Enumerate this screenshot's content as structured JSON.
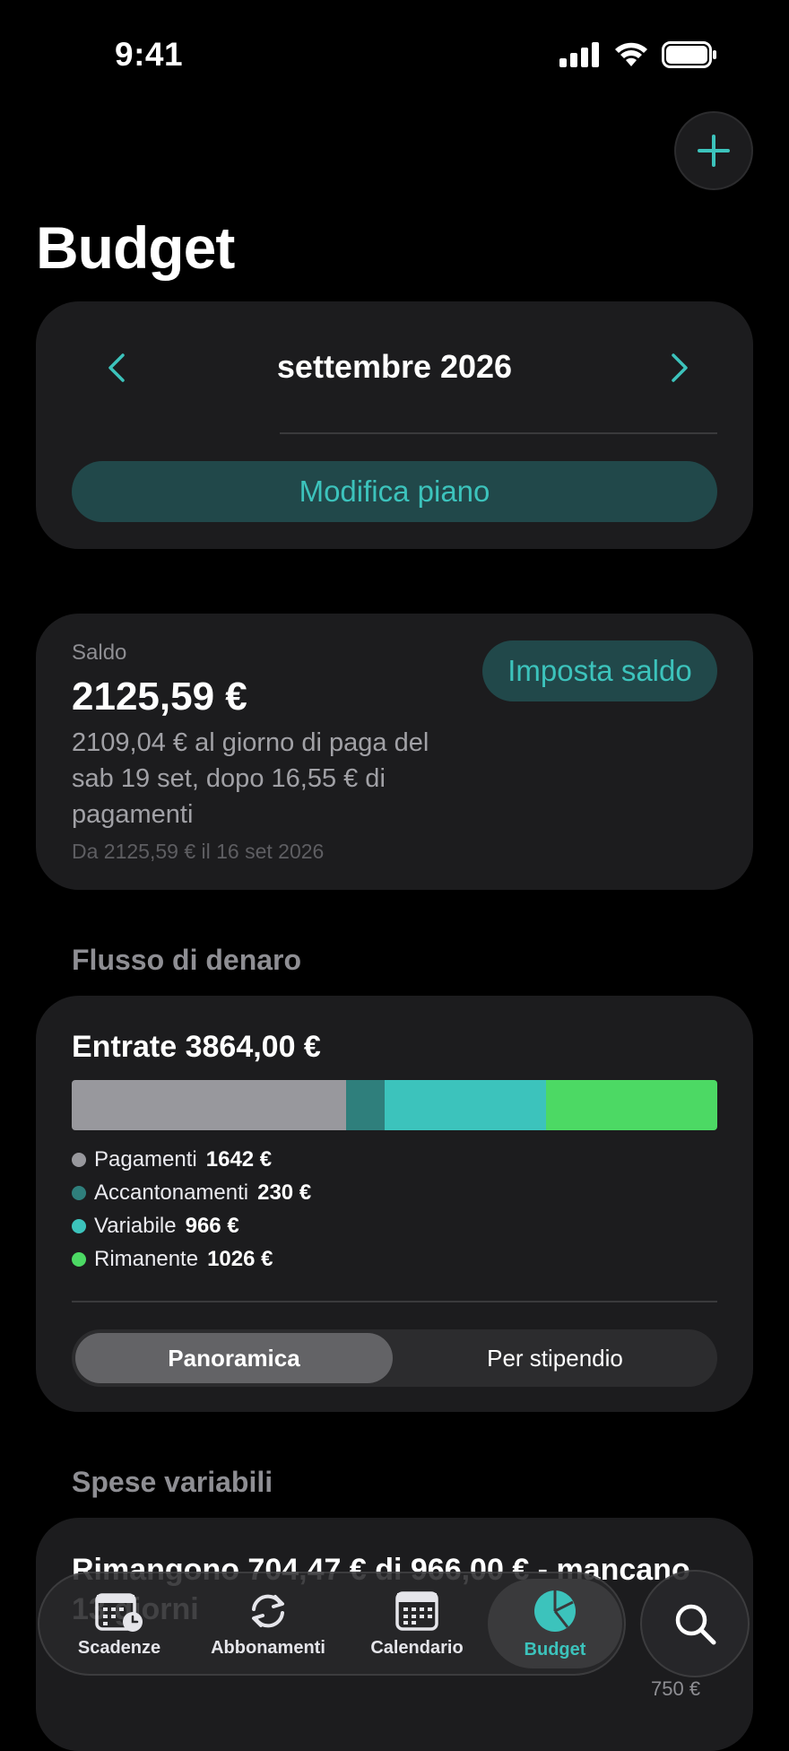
{
  "status_bar": {
    "time": "9:41"
  },
  "header": {
    "title": "Budget",
    "add_icon": "plus-icon"
  },
  "month_selector": {
    "label": "settembre 2026",
    "prev_icon": "chevron-left-icon",
    "next_icon": "chevron-right-icon",
    "edit_plan_label": "Modifica piano"
  },
  "balance": {
    "label": "Saldo",
    "amount": "2125,59 €",
    "description": "2109,04 € al giorno di paga del sab 19 set, dopo 16,55 € di pagamenti",
    "from_note": "Da 2125,59 € il 16 set 2026",
    "set_button": "Imposta saldo"
  },
  "cash_flow": {
    "section_title": "Flusso di denaro",
    "income_label": "Entrate 3864,00 €",
    "legend": [
      {
        "name": "Pagamenti",
        "value": "1642 €",
        "color": "#98989d"
      },
      {
        "name": "Accantonamenti",
        "value": "230 €",
        "color": "#2f7f7c"
      },
      {
        "name": "Variabile",
        "value": "966 €",
        "color": "#3cc3bc"
      },
      {
        "name": "Rimanente",
        "value": "1026 €",
        "color": "#4cd964"
      }
    ],
    "segments": {
      "overview": "Panoramica",
      "per_paycheck": "Per stipendio"
    }
  },
  "variable_spending": {
    "section_title": "Spese variabili",
    "summary": "Rimangono 704,47 € di 966,00 € - mancano 13 giorni",
    "chart_label": "750 €"
  },
  "tab_bar": {
    "tabs": [
      {
        "label": "Scadenze",
        "icon": "calendar-clock-icon"
      },
      {
        "label": "Abbonamenti",
        "icon": "refresh-icon"
      },
      {
        "label": "Calendario",
        "icon": "calendar-icon"
      },
      {
        "label": "Budget",
        "icon": "pie-chart-icon"
      }
    ],
    "search_icon": "search-icon"
  },
  "colors": {
    "accent": "#3cc3bc",
    "accent_bg": "#21484a",
    "card": "#1c1c1e",
    "background": "#000000"
  }
}
